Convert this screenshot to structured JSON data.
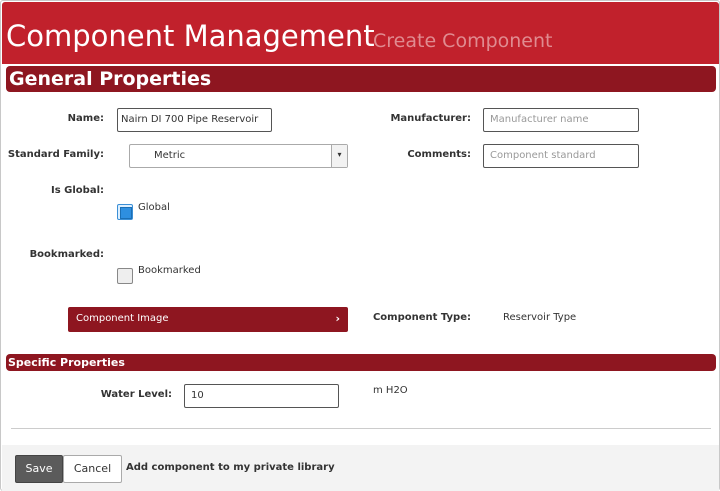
{
  "header": {
    "title": "Component Management",
    "subtitle": "Create Component"
  },
  "general": {
    "section_title": "General Properties",
    "name_label": "Name:",
    "name_value": "Nairn DI 700 Pipe Reservoir",
    "manufacturer_label": "Manufacturer:",
    "manufacturer_placeholder": "Manufacturer name",
    "standard_family_label": "Standard Family:",
    "standard_family_value": "Metric",
    "comments_label": "Comments:",
    "comments_placeholder": "Component standard",
    "is_global_label": "Is Global:",
    "global_checkbox_label": "Global",
    "global_checked": true,
    "bookmarked_label": "Bookmarked:",
    "bookmarked_checkbox_label": "Bookmarked",
    "bookmarked_checked": false,
    "component_image_label": "Component Image",
    "component_type_label": "Component Type:",
    "component_type_value": "Reservoir Type"
  },
  "specific": {
    "section_title": "Specific Properties",
    "water_level_label": "Water Level:",
    "water_level_value": "10",
    "water_level_unit": "m H2O"
  },
  "footer": {
    "save_label": "Save",
    "cancel_label": "Cancel",
    "private_library_text": "Add component to my private library"
  },
  "colors": {
    "header_red": "#c1212c",
    "section_dark_red": "#8e1620",
    "checkbox_blue": "#2e8fe0"
  },
  "icons": {
    "dropdown": "chevron-down-icon",
    "image_button": "chevron-right-icon"
  }
}
